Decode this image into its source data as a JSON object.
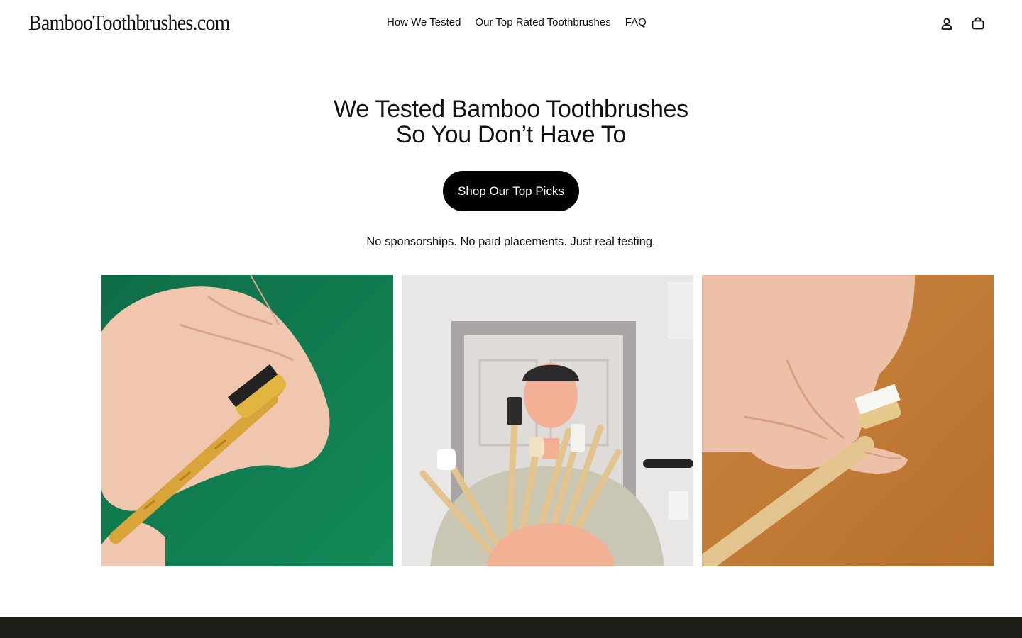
{
  "header": {
    "logo": "BambooToothbrushes.com",
    "nav": [
      {
        "label": "How We Tested"
      },
      {
        "label": "Our Top Rated Toothbrushes"
      },
      {
        "label": "FAQ"
      }
    ],
    "icons": [
      "account-icon",
      "cart-icon"
    ]
  },
  "hero": {
    "title_line1": "We Tested Bamboo Toothbrushes",
    "title_line2": "So You Don’t Have To",
    "cta_label": "Shop Our Top Picks",
    "tagline": "No sponsorships. No paid placements. Just real testing."
  },
  "gallery": [
    {
      "subject": "hand holding charcoal-bristle bamboo toothbrush on green background"
    },
    {
      "subject": "man holding many bamboo toothbrushes in front of door"
    },
    {
      "subject": "fingers holding white-bristle bamboo toothbrush on orange background"
    }
  ],
  "colors": {
    "cta_bg": "#000000",
    "footer_band": "#1f1f1a",
    "photo1_bg": "#117a4e",
    "photo3_bg": "#c07a35"
  }
}
